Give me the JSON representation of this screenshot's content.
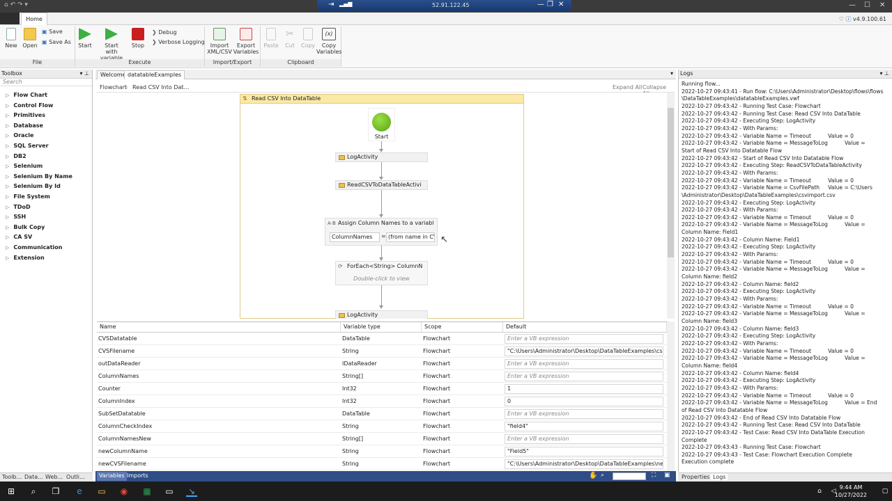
{
  "window": {
    "rdp_ip": "52.91.122.45",
    "version": "v4.9.100.61"
  },
  "ribbon": {
    "tab": "Home",
    "file": {
      "label": "File",
      "new": "New",
      "open": "Open",
      "save": "Save",
      "save_as": "Save As"
    },
    "execute": {
      "label": "Execute",
      "start": "Start",
      "start_var_1": "Start",
      "start_var_2": "with variable",
      "stop": "Stop",
      "debug": "Debug",
      "verbose": "Verbose Logging"
    },
    "importexport": {
      "label": "Import/Export",
      "import_1": "Import",
      "import_2": "XML/CSV",
      "export_1": "Export",
      "export_2": "Variables"
    },
    "clipboard": {
      "label": "Clipboard",
      "paste": "Paste",
      "cut": "Cut",
      "copy": "Copy",
      "copyvar_1": "Copy",
      "copyvar_2": "Variables",
      "copyvar_icon": "(x)"
    }
  },
  "toolbox": {
    "title": "Toolbox",
    "search_placeholder": "Search",
    "items": [
      "Flow Chart",
      "Control Flow",
      "Primitives",
      "Database",
      "Oracle",
      "SQL Server",
      "DB2",
      "Selenium",
      "Selenium By Name",
      "Selenium By Id",
      "File System",
      "TDoD",
      "SSH",
      "Bulk Copy",
      "CA SV",
      "Communication",
      "Extension"
    ],
    "tabs": [
      "Toolb...",
      "Data...",
      "Web...",
      "Outli..."
    ]
  },
  "designer": {
    "tabs": [
      "Welcome",
      "datatableExamples"
    ],
    "breadcrumb": [
      "Flowchart",
      "Read CSV Into Dat..."
    ],
    "expand_all": "Expand All",
    "collapse_all": "Collapse All",
    "flow_title": "Read CSV Into DataTable",
    "start_label": "Start",
    "activities": {
      "log1": "LogActivity",
      "readcsv": "ReadCSVToDataTableActivi",
      "assign": "Assign Column Names to a variabl",
      "assign_to": "ColumnNames",
      "assign_eq": "=",
      "assign_value": "(from name in CVS",
      "foreach": "ForEach<String> ColumnN",
      "foreach_hint": "Double-click to view",
      "log2": "LogActivity"
    }
  },
  "variables": {
    "headers": {
      "name": "Name",
      "type": "Variable type",
      "scope": "Scope",
      "default": "Default"
    },
    "placeholder": "Enter a VB expression",
    "rows": [
      {
        "name": "CVSDatatable",
        "type": "DataTable",
        "scope": "Flowchart",
        "default": ""
      },
      {
        "name": "CVSFilename",
        "type": "String",
        "scope": "Flowchart",
        "default": "\"C:\\Users\\Administrator\\Desktop\\DataTableExamples\\csvimpor"
      },
      {
        "name": "outDataReader",
        "type": "IDataReader",
        "scope": "Flowchart",
        "default": ""
      },
      {
        "name": "ColumnNames",
        "type": "String[]",
        "scope": "Flowchart",
        "default": ""
      },
      {
        "name": "Counter",
        "type": "Int32",
        "scope": "Flowchart",
        "default": "1"
      },
      {
        "name": "ColumnIndex",
        "type": "Int32",
        "scope": "Flowchart",
        "default": "0"
      },
      {
        "name": "SubSetDatatable",
        "type": "DataTable",
        "scope": "Flowchart",
        "default": ""
      },
      {
        "name": "ColumnCheckIndex",
        "type": "String",
        "scope": "Flowchart",
        "default": "\"field4\""
      },
      {
        "name": "ColumnNamesNew",
        "type": "String[]",
        "scope": "Flowchart",
        "default": ""
      },
      {
        "name": "newColumnName",
        "type": "String",
        "scope": "Flowchart",
        "default": "\"Field5\""
      },
      {
        "name": "newCVSFilename",
        "type": "String",
        "scope": "Flowchart",
        "default": "\"C:\\Users\\Administrator\\Desktop\\DataTableExamples\\newcsvim"
      }
    ],
    "tabs": [
      "Variables",
      "Imports"
    ]
  },
  "logs": {
    "title": "Logs",
    "text": "Running flow...\n2022-10-27 09:43:41 - Run flow: C:\\Users\\Administrator\\Desktop\\flows\\flows\n\\DataTableExamples\\datatableExamples.vwf\n2022-10-27 09:43:42 - Running Test Case: Flowchart\n2022-10-27 09:43:42 - Running Test Case: Read CSV Into DataTable\n2022-10-27 09:43:42 - Executing Step: LogActivity\n2022-10-27 09:43:42 - With Params:\n2022-10-27 09:43:42 - Variable Name = Timeout          Value = 0\n2022-10-27 09:43:42 - Variable Name = MessageToLog          Value =\nStart of Read CSV Into Datatable Flow\n2022-10-27 09:43:42 - Start of Read CSV Into Datatable Flow\n2022-10-27 09:43:42 - Executing Step: ReadCSVToDataTableActivity\n2022-10-27 09:43:42 - With Params:\n2022-10-27 09:43:42 - Variable Name = Timeout          Value = 0\n2022-10-27 09:43:42 - Variable Name = CsvFilePath     Value = C:\\Users\n\\Administrator\\Desktop\\DataTableExamples\\csvimport.csv\n2022-10-27 09:43:42 - Executing Step: LogActivity\n2022-10-27 09:43:42 - With Params:\n2022-10-27 09:43:42 - Variable Name = Timeout          Value = 0\n2022-10-27 09:43:42 - Variable Name = MessageToLog          Value =\nColumn Name: Field1\n2022-10-27 09:43:42 - Column Name: Field1\n2022-10-27 09:43:42 - Executing Step: LogActivity\n2022-10-27 09:43:42 - With Params:\n2022-10-27 09:43:42 - Variable Name = Timeout          Value = 0\n2022-10-27 09:43:42 - Variable Name = MessageToLog          Value =\nColumn Name: field2\n2022-10-27 09:43:42 - Column Name: field2\n2022-10-27 09:43:42 - Executing Step: LogActivity\n2022-10-27 09:43:42 - With Params:\n2022-10-27 09:43:42 - Variable Name = Timeout          Value = 0\n2022-10-27 09:43:42 - Variable Name = MessageToLog          Value =\nColumn Name: field3\n2022-10-27 09:43:42 - Column Name: field3\n2022-10-27 09:43:42 - Executing Step: LogActivity\n2022-10-27 09:43:42 - With Params:\n2022-10-27 09:43:42 - Variable Name = Timeout          Value = 0\n2022-10-27 09:43:42 - Variable Name = MessageToLog          Value =\nColumn Name: field4\n2022-10-27 09:43:42 - Column Name: field4\n2022-10-27 09:43:42 - Executing Step: LogActivity\n2022-10-27 09:43:42 - With Params:\n2022-10-27 09:43:42 - Variable Name = Timeout          Value = 0\n2022-10-27 09:43:42 - Variable Name = MessageToLog          Value = End\nof Read CSV Into Datatable Flow\n2022-10-27 09:43:42 - End of Read CSV Into Datatable Flow\n2022-10-27 09:43:42 - Running Test Case: Read CSV Into DataTable\n2022-10-27 09:43:42 - Test Case: Read CSV Into DataTable Execution Complete\n2022-10-27 09:43:43 - Running Test Case: Flowchart\n2022-10-27 09:43:43 - Test Case: Flowchart Execution Complete\nExecution complete",
    "tabs": [
      "Properties",
      "Logs"
    ]
  },
  "taskbar": {
    "time": "9:44 AM",
    "date": "10/27/2022"
  }
}
